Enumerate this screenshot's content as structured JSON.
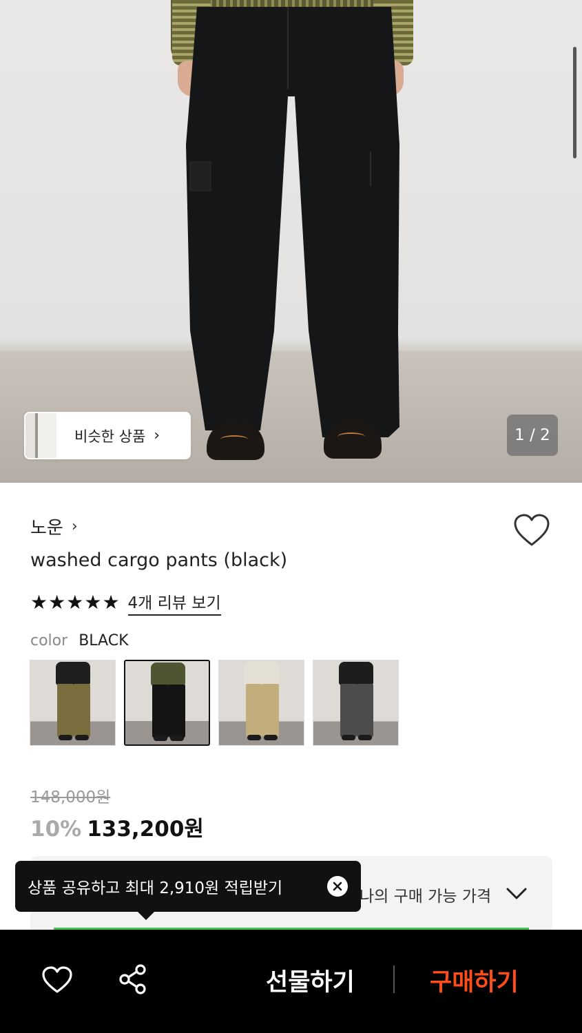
{
  "hero": {
    "similar_label": "비슷한 상품",
    "similar_chevron": "›",
    "page_indicator": "1 / 2"
  },
  "product": {
    "brand": "노운",
    "brand_chevron": "›",
    "title": "washed cargo pants (black)",
    "rating_stars": 5,
    "review_link": "4개 리뷰 보기",
    "color_key": "color",
    "color_value": "BLACK",
    "swatches": [
      {
        "name": "khaki-olive",
        "top_color": "#1f1f1f",
        "pants_color": "#7b6e3e"
      },
      {
        "name": "black",
        "top_color": "#4e5530",
        "pants_color": "#141414",
        "selected": true
      },
      {
        "name": "beige",
        "top_color": "#e5e0d6",
        "pants_color": "#c2ad7c"
      },
      {
        "name": "charcoal",
        "top_color": "#1d1d1d",
        "pants_color": "#4c4c4c"
      }
    ],
    "original_price": "148,000원",
    "discount": "10%",
    "sale_price": "133,200원",
    "my_price_label": "나의 구매 가능 가격"
  },
  "toast": {
    "text": "상품 공유하고 최대 2,910원 적립받기"
  },
  "bottom_bar": {
    "gift_label": "선물하기",
    "buy_label": "구매하기"
  },
  "colors": {
    "accent_buy": "#ff4d1a",
    "progress_green": "#44c24e",
    "bottom_bar_bg": "#000000"
  },
  "icons": [
    "chevron-right-icon",
    "heart-icon",
    "star-icon",
    "chevron-down-icon",
    "close-icon",
    "share-icon"
  ]
}
